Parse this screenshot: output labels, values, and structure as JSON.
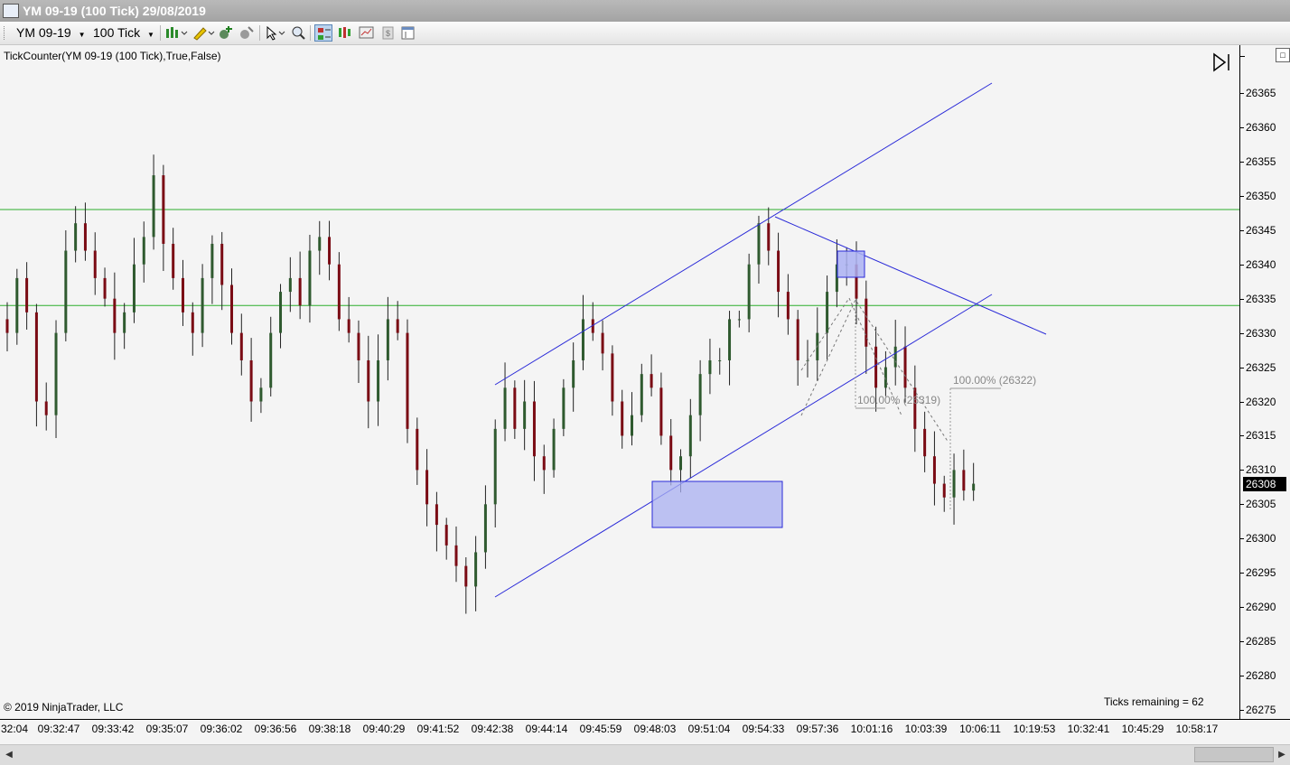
{
  "window": {
    "title": "YM 09-19 (100 Tick)  29/08/2019"
  },
  "toolbar": {
    "instrument": "YM 09-19",
    "interval": "100 Tick",
    "icons": [
      "bar-style-icon",
      "draw-pencil-icon",
      "add-indicator-icon",
      "strategy-icon",
      "cursor-icon",
      "zoom-icon",
      "chart-trader-icon",
      "data-box-icon",
      "properties-icon",
      "price-marker-icon",
      "window-layout-icon"
    ]
  },
  "chart": {
    "indicator_label": "TickCounter(YM 09-19  (100 Tick),True,False)",
    "copyright": "© 2019 NinjaTrader, LLC",
    "ticks_remaining": "Ticks remaining = 62",
    "last_price": "26308",
    "price_labels": [
      "26365",
      "26360",
      "26355",
      "26350",
      "26345",
      "26340",
      "26335",
      "26330",
      "26325",
      "26320",
      "26315",
      "26310",
      "26305",
      "26300",
      "26295",
      "26290",
      "26285",
      "26280",
      "26275"
    ],
    "time_labels": [
      "32:04",
      "09:32:47",
      "09:33:42",
      "09:35:07",
      "09:36:02",
      "09:36:56",
      "09:38:18",
      "09:40:29",
      "09:41:52",
      "09:42:38",
      "09:44:14",
      "09:45:59",
      "09:48:03",
      "09:51:04",
      "09:54:33",
      "09:57:36",
      "10:01:16",
      "10:03:39",
      "10:06:11",
      "10:19:53",
      "10:32:41",
      "10:45:29",
      "10:58:17"
    ],
    "fib_labels": [
      "100.00% (26322)",
      "100.00% (26319)"
    ],
    "colors": {
      "up": "#2f5a2f",
      "down": "#7a0b14",
      "line": "#2a2ad8",
      "horizontal": "#2cae2c",
      "rect": "#aab0f2"
    }
  },
  "chart_data": {
    "type": "candlestick",
    "instrument": "YM 09-19",
    "interval": "100 Tick",
    "ylim": [
      26273,
      26369
    ],
    "horizontal_lines": [
      26348,
      26334
    ],
    "last_price": 26308,
    "close_path": [
      26330,
      26338,
      26333,
      26320,
      26318,
      26330,
      26342,
      26346,
      26342,
      26338,
      26335,
      26330,
      26333,
      26340,
      26344,
      26353,
      26343,
      26338,
      26333,
      26330,
      26338,
      26343,
      26337,
      26330,
      26326,
      26320,
      26322,
      26330,
      26336,
      26338,
      26334,
      26342,
      26344,
      26340,
      26332,
      26330,
      26326,
      26320,
      26326,
      26332,
      26330,
      26316,
      26310,
      26305,
      26302,
      26299,
      26296,
      26293,
      26298,
      26305,
      26316,
      26322,
      26316,
      26320,
      26312,
      26310,
      26316,
      26322,
      26326,
      26332,
      26330,
      26327,
      26320,
      26315,
      26318,
      26324,
      26322,
      26315,
      26310,
      26312,
      26318,
      26324,
      26326,
      26326,
      26332,
      26332,
      26340,
      26346,
      26342,
      26336,
      26332,
      26326,
      26326,
      26330,
      26336,
      26340,
      26340,
      26335,
      26328,
      26322,
      26325,
      26328,
      26322,
      26316,
      26312,
      26308,
      26306,
      26310,
      26307,
      26308
    ]
  }
}
